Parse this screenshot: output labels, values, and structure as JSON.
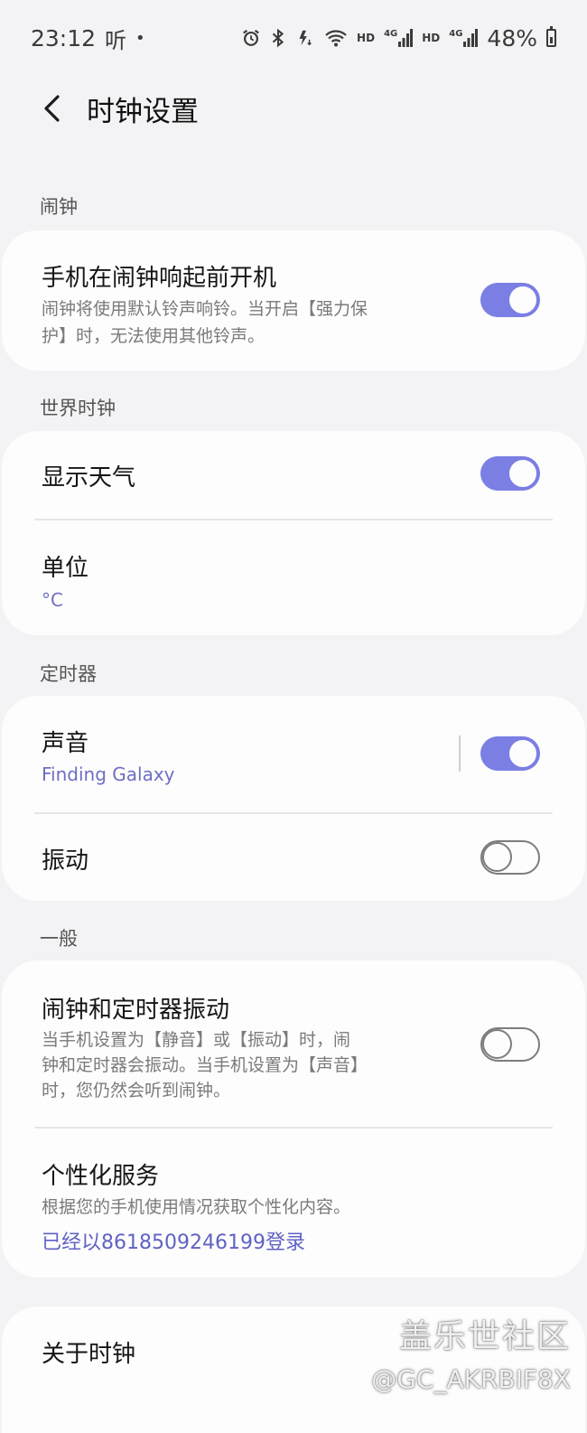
{
  "status_bar": {
    "time": "23:12",
    "carrier_glyph": "听",
    "dot": "•",
    "icons": [
      "alarm-icon",
      "bluetooth-icon",
      "data-icon",
      "wifi-icon"
    ],
    "hd1": "HD",
    "net1": "4G",
    "hd2": "HD",
    "net2": "4G",
    "battery_percent": "48%"
  },
  "app_bar": {
    "title": "时钟设置"
  },
  "sections": {
    "alarm": {
      "label": "闹钟",
      "power_on": {
        "title": "手机在闹钟响起前开机",
        "desc_line1": "闹钟将使用默认铃声响铃。当开启【强力保",
        "desc_line2": "护】时，无法使用其他铃声。",
        "enabled": true
      }
    },
    "world_clock": {
      "label": "世界时钟",
      "show_weather": {
        "title": "显示天气",
        "enabled": true
      },
      "unit": {
        "title": "单位",
        "value": "°C"
      }
    },
    "timer": {
      "label": "定时器",
      "sound": {
        "title": "声音",
        "value": "Finding Galaxy",
        "enabled": true
      },
      "vibration": {
        "title": "振动",
        "enabled": false
      }
    },
    "general": {
      "label": "一般",
      "alarm_timer_vibration": {
        "title": "闹钟和定时器振动",
        "desc_line1": "当手机设置为【静音】或【振动】时，闹",
        "desc_line2": "钟和定时器会振动。当手机设置为【声音】",
        "desc_line3": "时，您仍然会听到闹钟。",
        "enabled": false
      },
      "personalization": {
        "title": "个性化服务",
        "desc": "根据您的手机使用情况获取个性化内容。",
        "account": "已经以8618509246199登录"
      }
    },
    "about": {
      "title": "关于时钟"
    }
  },
  "watermark": {
    "line1": "盖乐世社区",
    "line2": "@GC_AKRBIF8X"
  },
  "colors": {
    "accent": "#7b7ee3",
    "background": "#f3f3f5",
    "card": "#fdfdfd"
  }
}
